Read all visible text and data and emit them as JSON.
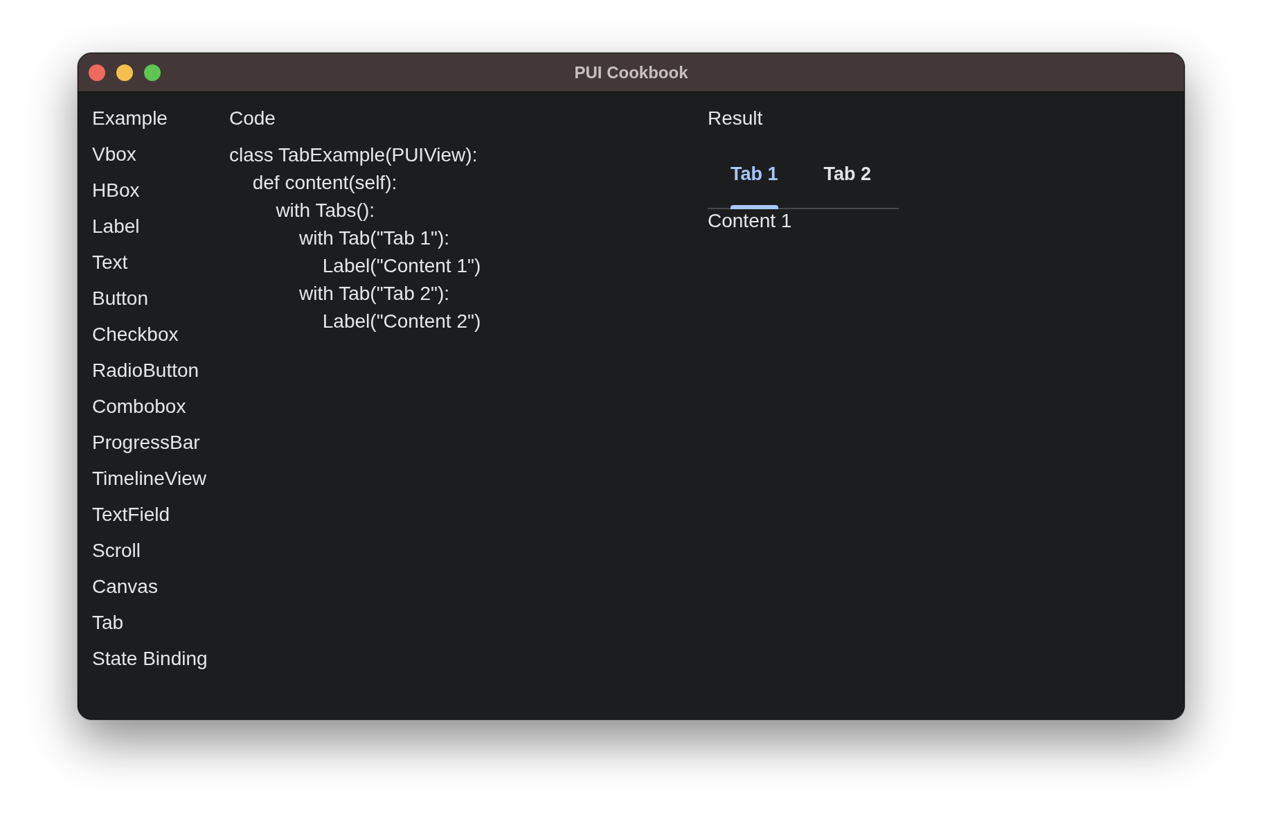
{
  "window": {
    "title": "PUI Cookbook"
  },
  "sidebar": {
    "heading": "Example",
    "items": [
      "Vbox",
      "HBox",
      "Label",
      "Text",
      "Button",
      "Checkbox",
      "RadioButton",
      "Combobox",
      "ProgressBar",
      "TimelineView",
      "TextField",
      "Scroll",
      "Canvas",
      "Tab",
      "State Binding"
    ]
  },
  "code": {
    "heading": "Code",
    "lines": [
      {
        "text": "class TabExample(PUIView):",
        "children": [
          {
            "text": "def content(self):",
            "children": [
              {
                "text": "with Tabs():",
                "children": [
                  {
                    "text": "with Tab(\"Tab 1\"):",
                    "children": [
                      {
                        "text": "Label(\"Content 1\")"
                      }
                    ]
                  },
                  {
                    "text": "with Tab(\"Tab 2\"):",
                    "children": [
                      {
                        "text": "Label(\"Content 2\")"
                      }
                    ]
                  }
                ]
              }
            ]
          }
        ]
      }
    ]
  },
  "result": {
    "heading": "Result",
    "tabs": [
      {
        "label": "Tab 1",
        "selected": true
      },
      {
        "label": "Tab 2",
        "selected": false
      }
    ],
    "content": "Content 1"
  }
}
